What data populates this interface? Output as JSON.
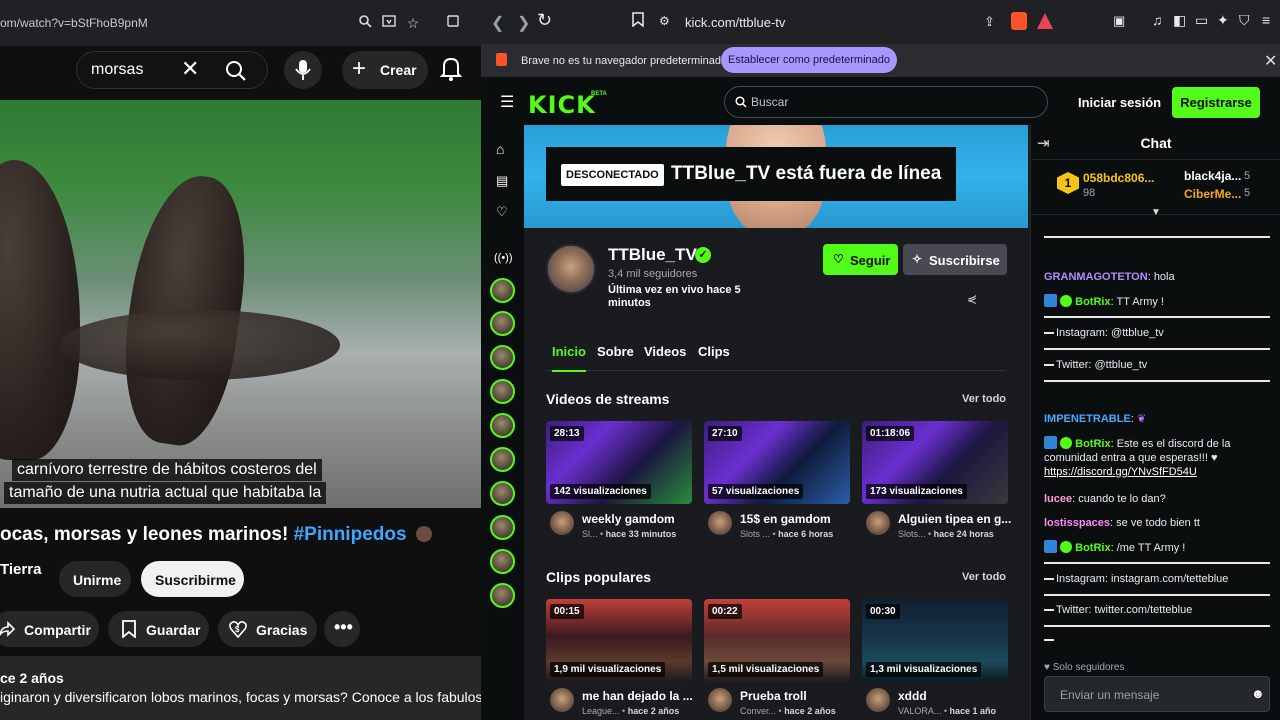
{
  "youtube": {
    "url": "om/watch?v=bStFhoB9pnM",
    "search_value": "morsas",
    "create_label": "Crear",
    "captions": [
      "carnívoro terrestre de hábitos costeros del",
      "tamaño de una nutria actual que habitaba la"
    ],
    "title_text": "ocas, morsas y leones marinos! ",
    "title_tag": "#Pinnipedos",
    "channel_name": "Tierra",
    "join_label": "Unirme",
    "subscribe_label": "Suscribirme",
    "share_label": "Compartir",
    "save_label": "Guardar",
    "thanks_label": "Gracias",
    "desc_ago": "ce 2 años",
    "desc_text": "iginaron y diversificaron lobos marinos, focas y morsas? Conoce a los fabulosos"
  },
  "browser": {
    "url": "kick.com/ttblue-tv",
    "info_message": "Brave no es tu navegador predeterminado",
    "info_button": "Establecer como predeterminado"
  },
  "kick": {
    "logo": "KICK",
    "beta": "BETA",
    "search_placeholder": "Buscar",
    "login_label": "Iniciar sesión",
    "register_label": "Registrarse",
    "banner_badge": "DESCONECTADO",
    "banner_text": "TTBlue_TV está fuera de línea",
    "channel": {
      "name": "TTBlue_TV",
      "followers": "3,4 mil seguidores",
      "last_live": "Última vez en vivo hace 5 minutos",
      "follow_label": "Seguir",
      "subscribe_label": "Suscribirse"
    },
    "tabs": [
      "Inicio",
      "Sobre",
      "Videos",
      "Clips"
    ],
    "streams_title": "Videos de streams",
    "clips_title": "Clips populares",
    "see_all": "Ver todo",
    "streams": [
      {
        "duration": "28:13",
        "views": "142 visualizaciones",
        "title": "weekly gamdom",
        "category": "Sl...",
        "ago": "hace 33 minutos"
      },
      {
        "duration": "27:10",
        "views": "57 visualizaciones",
        "title": "15$ en gamdom",
        "category": "Slots ...",
        "ago": "hace 6 horas"
      },
      {
        "duration": "01:18:06",
        "views": "173 visualizaciones",
        "title": "Alguien tipea en g...",
        "category": "Slots...",
        "ago": "hace 24 horas"
      }
    ],
    "clips": [
      {
        "duration": "00:15",
        "views": "1,9 mil visualizaciones",
        "title": "me han dejado la ...",
        "category": "League...",
        "ago": "hace 2 años"
      },
      {
        "duration": "00:22",
        "views": "1,5 mil visualizaciones",
        "title": "Prueba troll",
        "category": "Conver...",
        "ago": "hace 2 años"
      },
      {
        "duration": "00:30",
        "views": "1,3 mil visualizaciones",
        "title": "xddd",
        "category": "VALORA...",
        "ago": "hace 1 año"
      }
    ],
    "chat": {
      "title": "Chat",
      "leaders": [
        {
          "name": "058bdc806...",
          "value": "98"
        },
        {
          "name": "black4ja...",
          "value": "5"
        },
        {
          "name": "CiberMe...",
          "value": "5"
        }
      ],
      "rank": "1",
      "messages": [
        {
          "user": "GRANMAGOTETON",
          "text": "hola"
        },
        {
          "user": "BotRix",
          "text": "TT Army !"
        },
        {
          "user": "",
          "text": "Instagram: @ttblue_tv"
        },
        {
          "user": "",
          "text": "Twitter: @ttblue_tv"
        },
        {
          "user": "IMPENETRABLE",
          "text": ""
        },
        {
          "user": "BotRix",
          "text": "Este es el discord de la comunidad entra a que esperas!!! ♥"
        },
        {
          "user": "",
          "text": "https://discord.gg/YNvSfFD54U"
        },
        {
          "user": "lucee",
          "text": "cuando te lo dan?"
        },
        {
          "user": "lostisspaces",
          "text": "se ve todo bien tt"
        },
        {
          "user": "BotRix",
          "text": "/me TT Army !"
        },
        {
          "user": "",
          "text": "Instagram: instagram.com/tetteblue"
        },
        {
          "user": "",
          "text": "Twitter: twitter.com/tetteblue"
        }
      ],
      "only_followers": "Solo seguidores",
      "input_placeholder": "Enviar un mensaje"
    }
  },
  "colors": {
    "kick_green": "#53fc18",
    "yt_link": "#3ea6ff",
    "brave_button": "#a798ff"
  }
}
